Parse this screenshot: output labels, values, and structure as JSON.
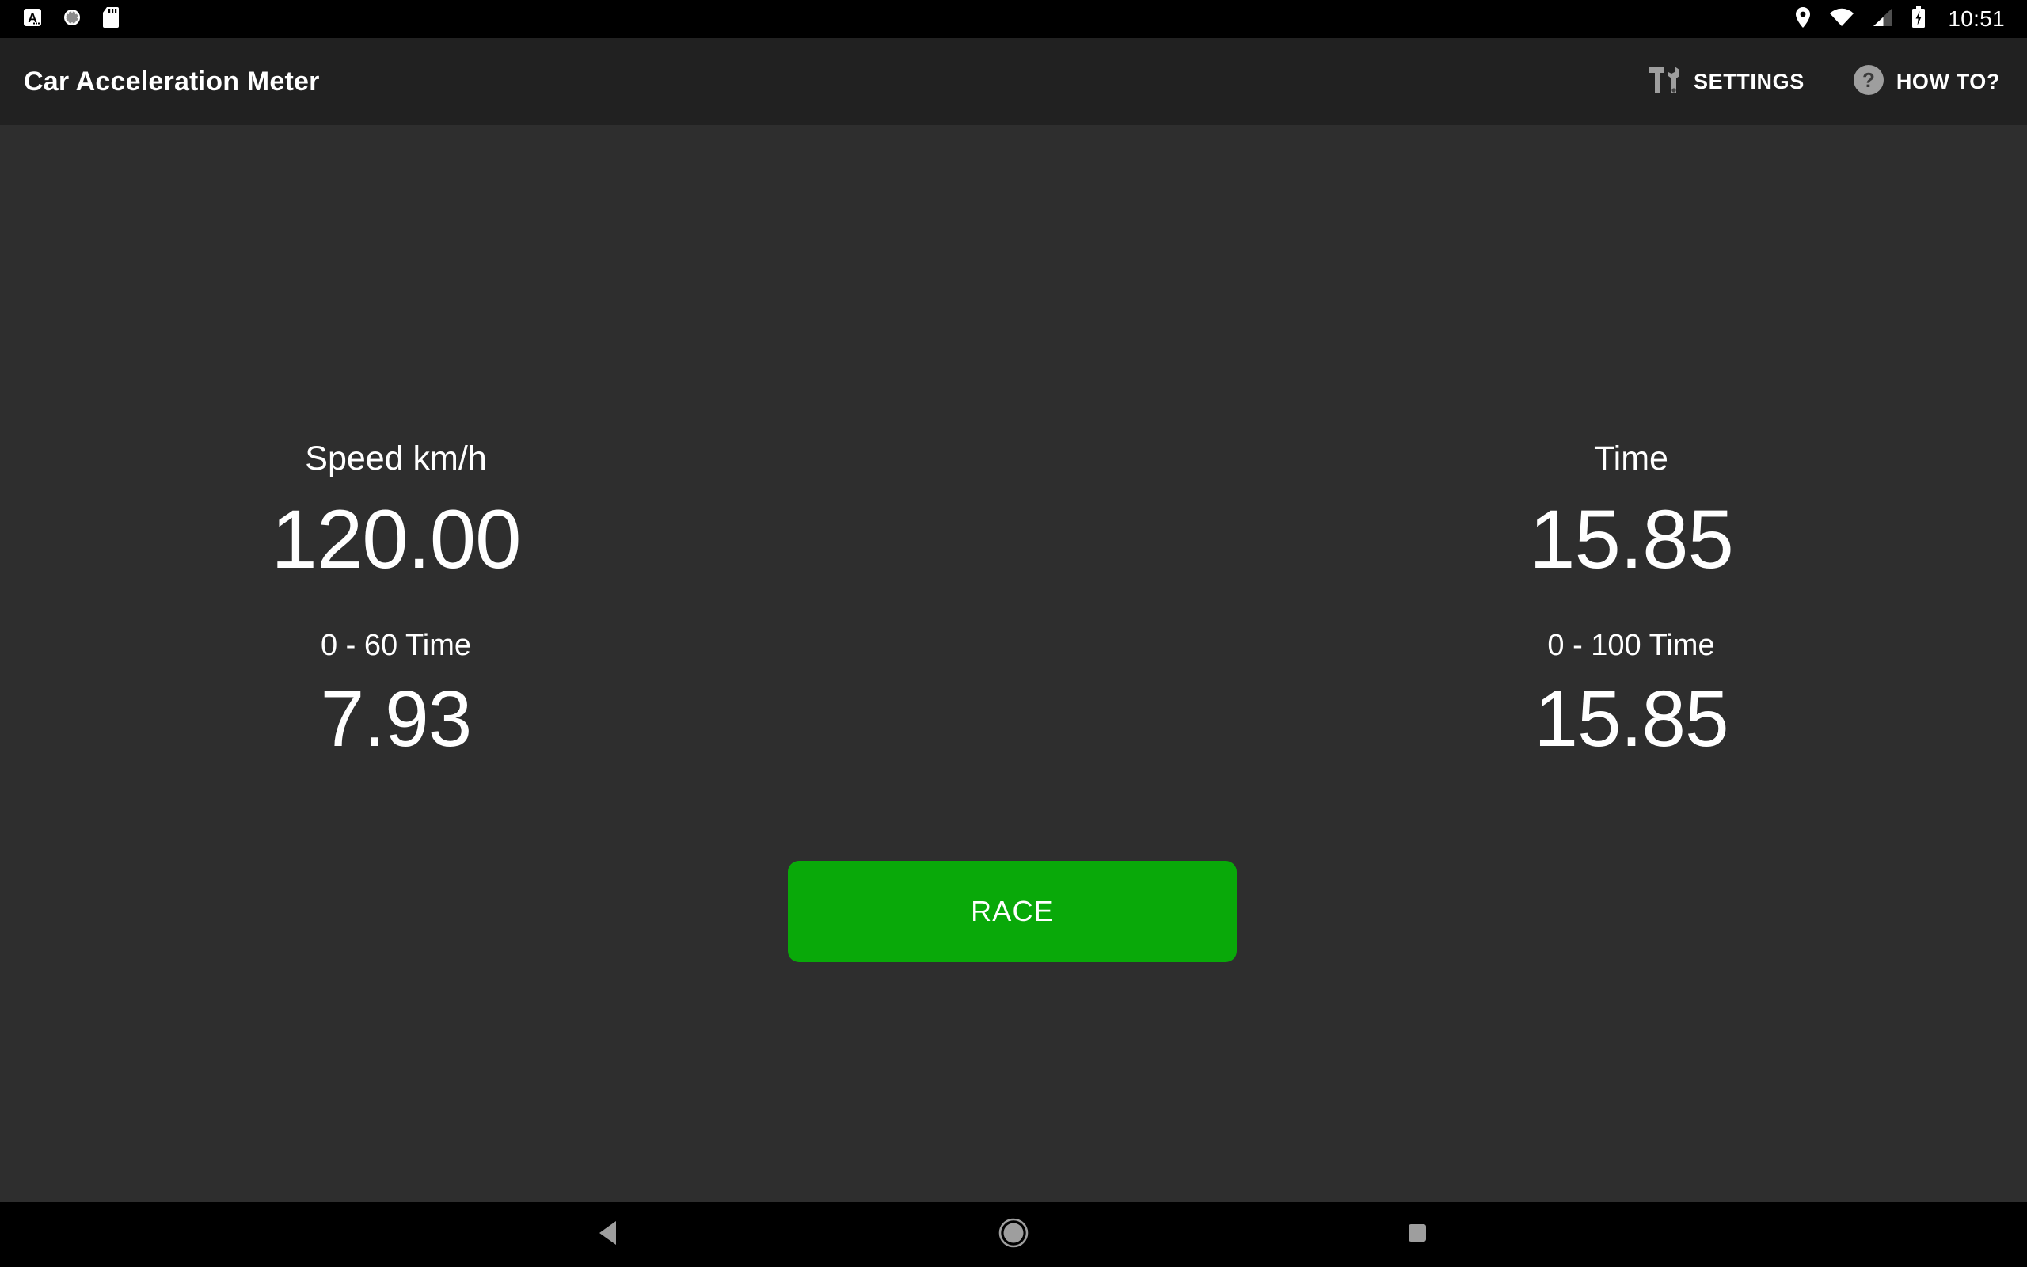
{
  "status_bar": {
    "left_icons": [
      {
        "name": "a-letter-icon",
        "glyph": "A"
      },
      {
        "name": "sync-spinner-icon",
        "glyph": ""
      },
      {
        "name": "sd-card-icon",
        "glyph": ""
      }
    ],
    "right_icons": [
      {
        "name": "location-pin-icon"
      },
      {
        "name": "wifi-icon"
      },
      {
        "name": "cellular-signal-icon"
      },
      {
        "name": "battery-charging-icon"
      }
    ],
    "clock": "10:51"
  },
  "action_bar": {
    "title": "Car Acceleration Meter",
    "settings_label": "SETTINGS",
    "settings_icon": "tools-hammer-wrench-icon",
    "howto_label": "HOW TO?",
    "howto_icon": "help-question-circle-icon"
  },
  "main": {
    "speed": {
      "label": "Speed km/h",
      "value": "120.00"
    },
    "time": {
      "label": "Time",
      "value": "15.85"
    },
    "zero_sixty": {
      "label": "0 - 60 Time",
      "value": "7.93"
    },
    "zero_hundred": {
      "label": "0 - 100 Time",
      "value": "15.85"
    },
    "race_button": {
      "label": "RACE",
      "color": "#09a909"
    }
  },
  "nav_bar": {
    "back": "back-triangle-icon",
    "home": "home-circle-icon",
    "recents": "recents-square-icon"
  },
  "colors": {
    "background": "#2e2e2e",
    "action_bar": "#212121",
    "status_bar": "#000000",
    "accent_green": "#09a909",
    "text": "#ffffff",
    "icon_gray": "#9e9e9e"
  }
}
